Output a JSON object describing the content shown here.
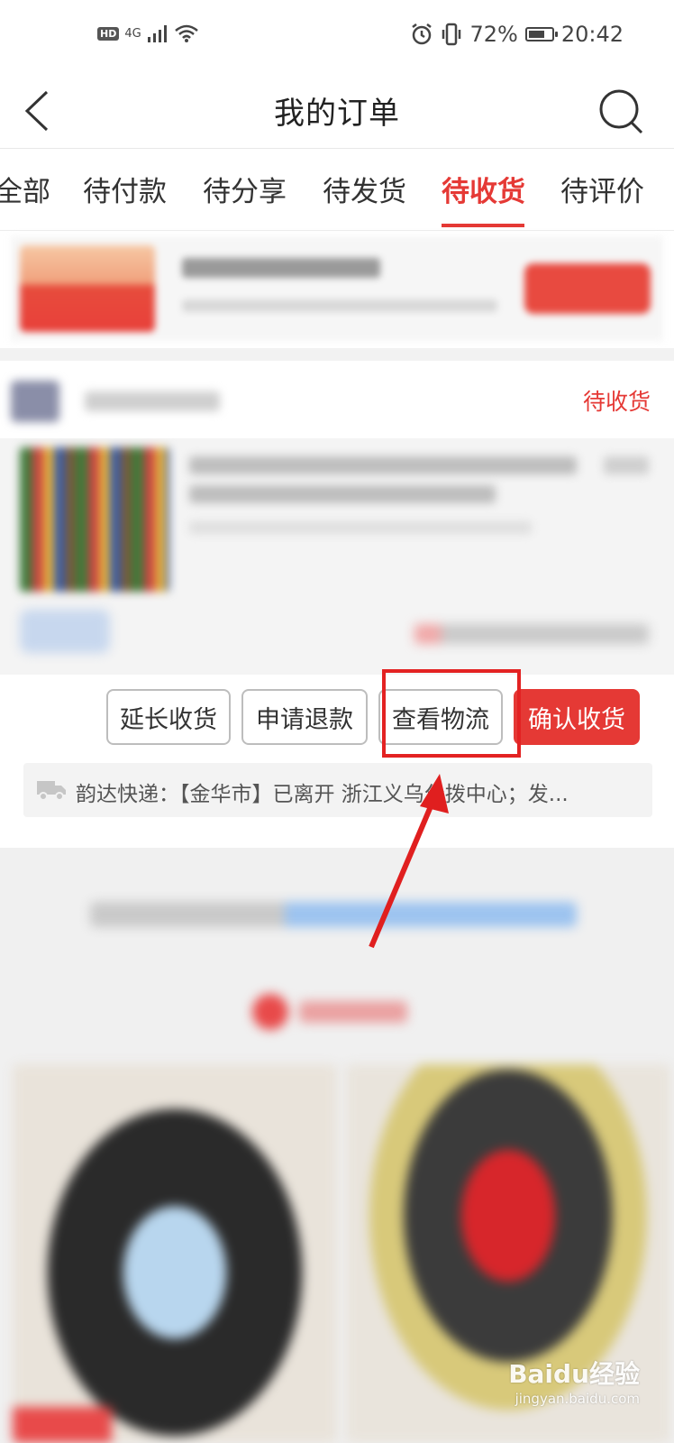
{
  "status_bar": {
    "hd": "HD",
    "network": "4G",
    "battery_text": "72%",
    "battery_level": 0.72,
    "time": "20:42"
  },
  "header": {
    "title": "我的订单"
  },
  "tabs": [
    {
      "label": "全部"
    },
    {
      "label": "待付款"
    },
    {
      "label": "待分享"
    },
    {
      "label": "待发货"
    },
    {
      "label": "待收货",
      "active": true
    },
    {
      "label": "待评价"
    }
  ],
  "order": {
    "status": "待收货",
    "actions": {
      "extend": "延长收货",
      "refund": "申请退款",
      "logistics": "查看物流",
      "confirm": "确认收货"
    },
    "logistics_info": "韵达快递：【金华市】已离开 浙江义乌分拨中心；发..."
  },
  "watermark": {
    "brand": "Baidu经验",
    "site": "jingyan.baidu.com"
  },
  "colors": {
    "accent": "#e53935",
    "highlight": "#e32222"
  }
}
